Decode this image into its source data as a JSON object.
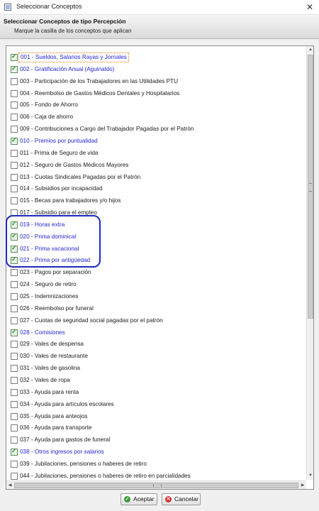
{
  "window": {
    "title": "Seleccionar Conceptos",
    "close_glyph": "✕"
  },
  "header": {
    "title": "Seleccionar Conceptos de tipo Percepción",
    "subtitle": "Marque la casilla de los conceptos que aplican"
  },
  "concepts": [
    {
      "label": "001 - Sueldos, Salarios  Rayas y Jornales",
      "checked": true
    },
    {
      "label": "002 - Gratificación Anual (Aguinaldo)",
      "checked": true
    },
    {
      "label": "003 - Participación de los Trabajadores en las Utilidades PTU",
      "checked": false
    },
    {
      "label": "004 - Reembolso de Gastos Médicos Dentales y Hospitalarios",
      "checked": false
    },
    {
      "label": "005 - Fondo de Ahorro",
      "checked": false
    },
    {
      "label": "006 - Caja de ahorro",
      "checked": false
    },
    {
      "label": "009 - Contribuciones a Cargo del Trabajador Pagadas por el Patrón",
      "checked": false
    },
    {
      "label": "010 - Premios por puntualidad",
      "checked": true
    },
    {
      "label": "011 - Prima de Seguro de vida",
      "checked": false
    },
    {
      "label": "012 - Seguro de Gastos Médicos Mayores",
      "checked": false
    },
    {
      "label": "013 - Cuotas Sindicales Pagadas por el Patrón",
      "checked": false
    },
    {
      "label": "014 - Subsidios por incapacidad",
      "checked": false
    },
    {
      "label": "015 - Becas para trabajadores y/o hijos",
      "checked": false
    },
    {
      "label": "017 - Subsidio para el empleo",
      "checked": false
    },
    {
      "label": "019 - Horas extra",
      "checked": true
    },
    {
      "label": "020 - Prima dominical",
      "checked": true
    },
    {
      "label": "021 - Prima vacacional",
      "checked": true
    },
    {
      "label": "022 - Prima por antigüedad",
      "checked": true
    },
    {
      "label": "023 - Pagos por separación",
      "checked": false
    },
    {
      "label": "024 - Seguro de retiro",
      "checked": false
    },
    {
      "label": "025 - Indemnizaciones",
      "checked": false
    },
    {
      "label": "026 - Reembolso por funeral",
      "checked": false
    },
    {
      "label": "027 - Cuotas de seguridad social pagadas por el patrón",
      "checked": false
    },
    {
      "label": "028 - Comisiones",
      "checked": true
    },
    {
      "label": "029 - Vales de despensa",
      "checked": false
    },
    {
      "label": "030 - Vales de restaurante",
      "checked": false
    },
    {
      "label": "031 - Vales de gasolina",
      "checked": false
    },
    {
      "label": "032 - Vales de ropa",
      "checked": false
    },
    {
      "label": "033 - Ayuda para renta",
      "checked": false
    },
    {
      "label": "034 - Ayuda para artículos escolares",
      "checked": false
    },
    {
      "label": "035 - Ayuda para anteojos",
      "checked": false
    },
    {
      "label": "036 - Ayuda para transporte",
      "checked": false
    },
    {
      "label": "037 - Ayuda para gastos de funeral",
      "checked": false
    },
    {
      "label": "038 - Otros ingresos por salarios",
      "checked": true
    },
    {
      "label": "039 - Jubilaciones, pensiones o haberes de retiro",
      "checked": false
    },
    {
      "label": "044 - Jubilaciones, pensiones o haberes de retiro en parcialidades",
      "checked": false
    }
  ],
  "buttons": {
    "accept_label": "Aceptar",
    "cancel_label": "Cancelar"
  },
  "colors": {
    "checked_text": "#2424d8",
    "highlight_border": "#1c2bbf",
    "accept_icon": "#3a9a3a",
    "cancel_icon": "#d83030"
  }
}
